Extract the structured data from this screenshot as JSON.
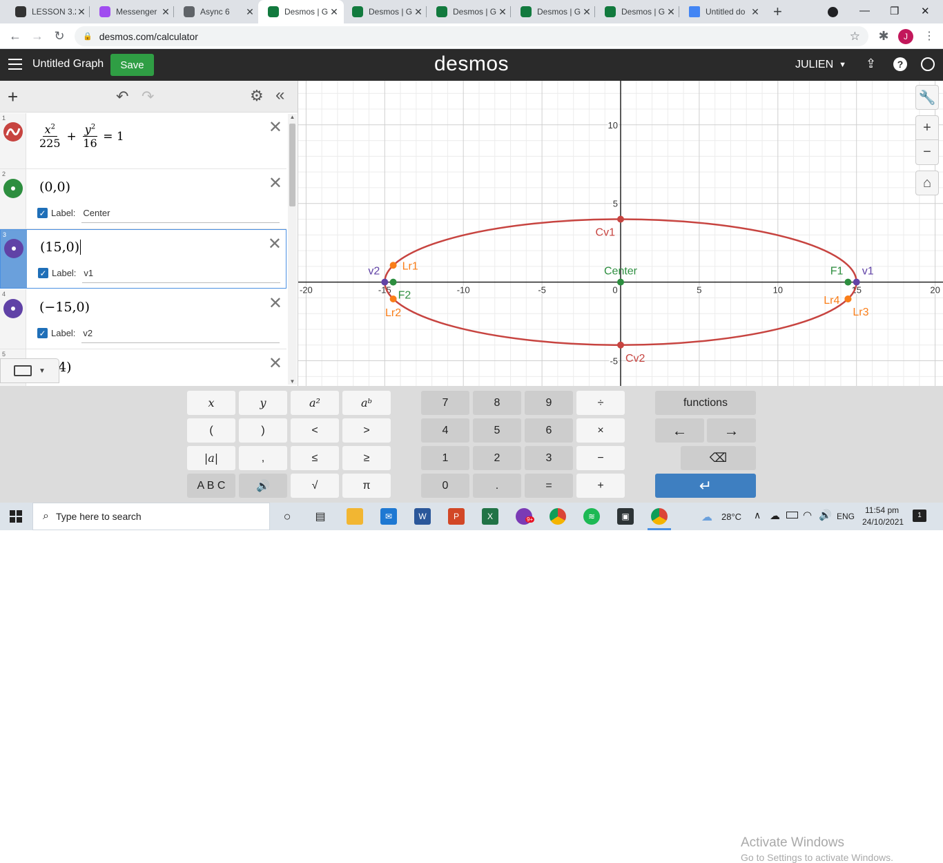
{
  "browser": {
    "tabs": [
      {
        "title": "LESSON 3.2",
        "icon": "sigma-icon",
        "color": "#333333"
      },
      {
        "title": "Messenger",
        "icon": "messenger-icon",
        "color": "#a04cf0"
      },
      {
        "title": "Async 6",
        "icon": "globe-icon",
        "color": "#5f6368"
      },
      {
        "title": "Desmos | G",
        "icon": "desmos-icon",
        "color": "#127a3e",
        "active": true
      },
      {
        "title": "Desmos | G",
        "icon": "desmos-icon",
        "color": "#127a3e"
      },
      {
        "title": "Desmos | G",
        "icon": "desmos-icon",
        "color": "#127a3e"
      },
      {
        "title": "Desmos | G",
        "icon": "desmos-icon",
        "color": "#127a3e"
      },
      {
        "title": "Desmos | G",
        "icon": "desmos-icon",
        "color": "#127a3e"
      },
      {
        "title": "Untitled do",
        "icon": "docs-icon",
        "color": "#4285f4"
      }
    ],
    "url": "desmos.com/calculator",
    "profile_initial": "J"
  },
  "header": {
    "graph_title": "Untitled Graph",
    "save_label": "Save",
    "logo": "desmos",
    "user": "JULIEN"
  },
  "expressions": [
    {
      "num": "1",
      "color": "#c74440"
    },
    {
      "num": "2",
      "color": "#2d8e3f",
      "math": "(0,0)",
      "label_prefix": "Label:",
      "label": "Center"
    },
    {
      "num": "3",
      "color": "#6042a6",
      "math": "(15,0)",
      "label_prefix": "Label:",
      "label": "v1",
      "selected": true
    },
    {
      "num": "4",
      "color": "#6042a6",
      "math": "(−15,0)",
      "label_prefix": "Label:",
      "label": "v2"
    },
    {
      "num": "5",
      "math_partial": "4)"
    }
  ],
  "equation": {
    "n1": "x",
    "e1": "2",
    "d1": "225",
    "n2": "y",
    "e2": "2",
    "d2": "16",
    "rhs": "= 1"
  },
  "chart_data": {
    "type": "scatter",
    "xlim": [
      -20.5,
      20.5
    ],
    "ylim": [
      -6.6,
      12.8
    ],
    "grid": true,
    "x_ticks": [
      "-20",
      "-15",
      "-10",
      "-5",
      "0",
      "5",
      "10",
      "15",
      "20"
    ],
    "y_ticks": [
      "10",
      "5",
      "-5"
    ],
    "curve": {
      "a": 15,
      "b": 4,
      "color": "#c74440"
    },
    "points": [
      {
        "label": "Center",
        "x": 0,
        "y": 0,
        "color": "#2d8e3f",
        "align": "top"
      },
      {
        "label": "v1",
        "x": 15,
        "y": 0,
        "color": "#6042a6",
        "align": "right-top"
      },
      {
        "label": "v2",
        "x": -15,
        "y": 0,
        "color": "#6042a6",
        "align": "left-top"
      },
      {
        "label": "F1",
        "x": 14.46,
        "y": 0,
        "color": "#2d8e3f",
        "align": "left-top"
      },
      {
        "label": "F2",
        "x": -14.46,
        "y": 0,
        "color": "#2d8e3f",
        "align": "right-bottom"
      },
      {
        "label": "Cv1",
        "x": 0,
        "y": 4,
        "color": "#c74440",
        "align": "bottom-left"
      },
      {
        "label": "Cv2",
        "x": 0,
        "y": -4,
        "color": "#c74440",
        "align": "bottom-right"
      },
      {
        "label": "Lr1",
        "x": -14.46,
        "y": 1.07,
        "color": "#fa7e19",
        "align": "right"
      },
      {
        "label": "Lr2",
        "x": -14.46,
        "y": -1.07,
        "color": "#fa7e19",
        "align": "bottom"
      },
      {
        "label": "Lr3",
        "x": 14.46,
        "y": -1.07,
        "color": "#fa7e19",
        "align": "right-bottom"
      },
      {
        "label": "Lr4",
        "x": 14.46,
        "y": -1.07,
        "color": "#fa7e19",
        "align": "left"
      }
    ]
  },
  "keypad": {
    "col1": [
      "x",
      "y",
      "a²",
      "aᵇ",
      "(",
      ")",
      "<",
      ">",
      "|a|",
      ",",
      "≤",
      "≥",
      "A B C",
      "🔊",
      "√",
      "π"
    ],
    "col2": [
      "7",
      "8",
      "9",
      "÷",
      "4",
      "5",
      "6",
      "×",
      "1",
      "2",
      "3",
      "−",
      "0",
      ".",
      "=",
      "+"
    ],
    "functions": "functions",
    "left_arrow": "←",
    "right_arrow": "→",
    "backspace": "⌫",
    "enter": "↵"
  },
  "watermark": {
    "title": "Activate Windows",
    "subtitle": "Go to Settings to activate Windows."
  },
  "taskbar": {
    "search_placeholder": "Type here to search",
    "temperature": "28°C",
    "language": "ENG",
    "time": "11:54 pm",
    "date": "24/10/2021",
    "notifications": "1",
    "badge": "9+"
  }
}
